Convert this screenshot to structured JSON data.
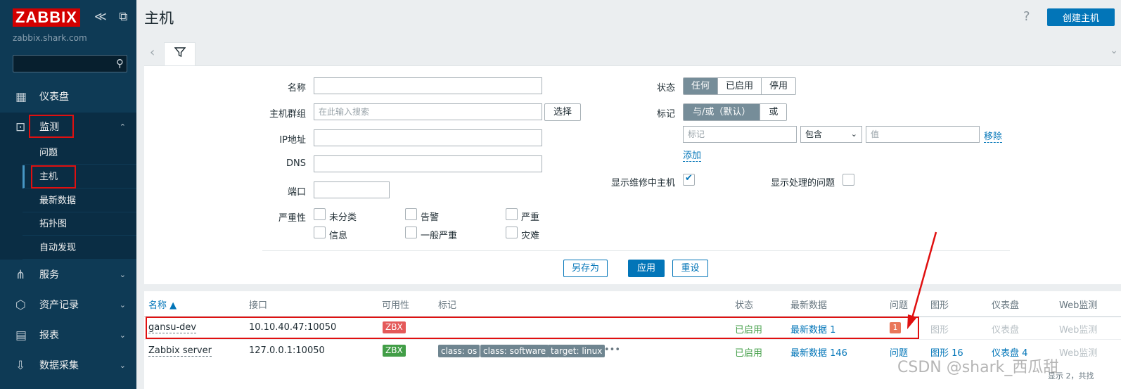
{
  "sidebar": {
    "logo": "ZABBIX",
    "server": "zabbix.shark.com",
    "search_placeholder": "",
    "collapse_icons": "≪ ⧉",
    "items": {
      "dashboard": "仪表盘",
      "monitoring": "监测",
      "services": "服务",
      "inventory": "资产记录",
      "reports": "报表",
      "datacollection": "数据采集"
    },
    "monitoring_sub": {
      "problems": "问题",
      "hosts": "主机",
      "latest": "最新数据",
      "maps": "拓扑图",
      "discovery": "自动发现"
    }
  },
  "header": {
    "title": "主机",
    "help": "?",
    "create_button": "创建主机"
  },
  "filter": {
    "labels": {
      "name": "名称",
      "hostgroups": "主机群组",
      "ip": "IP地址",
      "dns": "DNS",
      "port": "端口",
      "severity": "严重性",
      "status": "状态",
      "tags": "标记",
      "maintenance": "显示维修中主机",
      "suppressed": "显示处理的问题"
    },
    "hostgroups_placeholder": "在此输入搜索",
    "select_button": "选择",
    "severity": {
      "not_classified": "未分类",
      "warning": "告警",
      "high": "严重",
      "information": "信息",
      "average": "一般严重",
      "disaster": "灾难"
    },
    "status_options": [
      "任何",
      "已启用",
      "停用"
    ],
    "status_selected": "任何",
    "tag_options": [
      "与/或（默认）",
      "或"
    ],
    "tag_placeholder": "标记",
    "tag_operator": "包含",
    "tag_value_placeholder": "值",
    "tag_remove": "移除",
    "tag_add": "添加",
    "maintenance_checked": true,
    "suppressed_checked": false,
    "buttons": {
      "save_as": "另存为",
      "apply": "应用",
      "reset": "重设"
    }
  },
  "table": {
    "headers": {
      "name": "名称 ▲",
      "interface": "接口",
      "availability": "可用性",
      "tags": "标记",
      "status": "状态",
      "latest": "最新数据",
      "problems": "问题",
      "graphs": "图形",
      "dashboards": "仪表盘",
      "web": "Web监测"
    },
    "rows": [
      {
        "name": "gansu-dev",
        "interface": "10.10.40.47:10050",
        "availability": "ZBX",
        "status": "已启用",
        "latest": "最新数据 1",
        "problems": "1",
        "graphs": "图形",
        "dashboards": "仪表盘",
        "web": "Web监测"
      },
      {
        "name": "Zabbix server",
        "interface": "127.0.0.1:10050",
        "availability": "ZBX",
        "tags": [
          "class: os",
          "class: software",
          "target: linux"
        ],
        "more": "•••",
        "status": "已启用",
        "latest": "最新数据 146",
        "problems": "问题",
        "graphs": "图形 16",
        "dashboards": "仪表盘 4",
        "web": "Web监测"
      }
    ],
    "footer": "显示 2，共找"
  },
  "watermark": "CSDN @shark_西瓜甜",
  "colors": {
    "sidebar": "#0e3a55",
    "accent": "#0275b8",
    "annotation": "#e01010"
  }
}
